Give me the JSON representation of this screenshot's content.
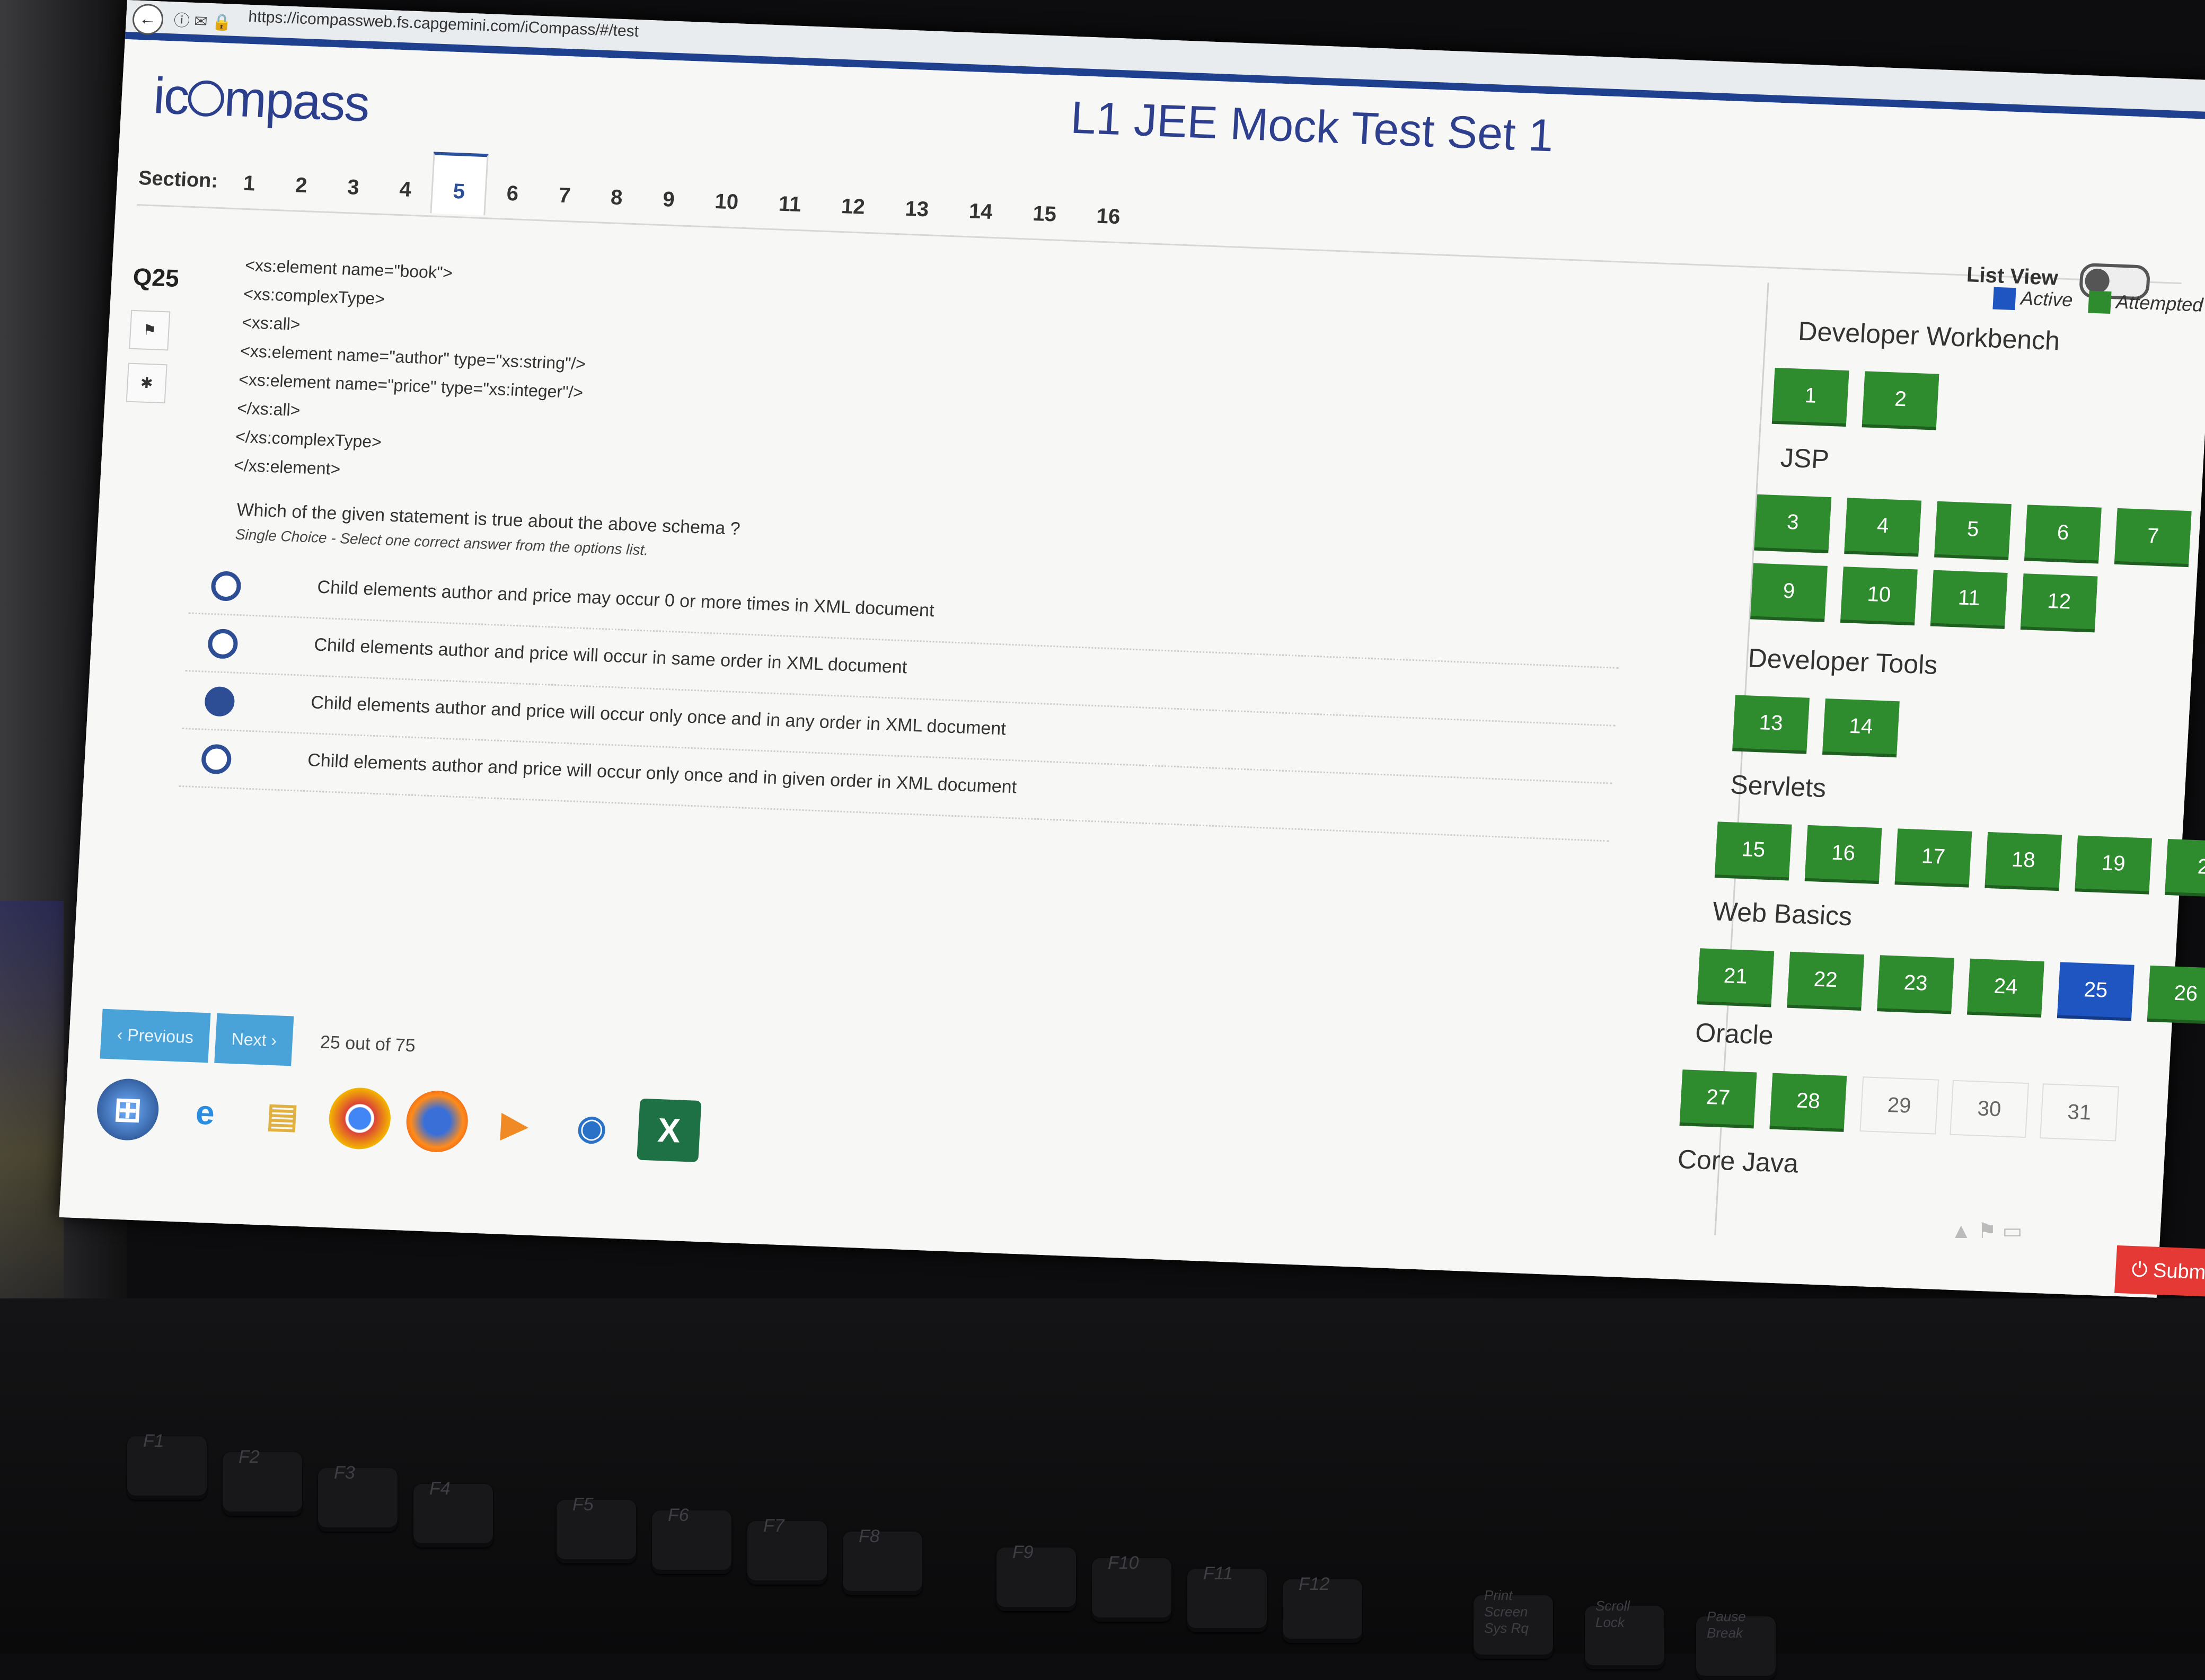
{
  "browser": {
    "url": "https://icompassweb.fs.capgemini.com/iCompass/#/test",
    "back_icon": "arrow-left-icon"
  },
  "app": {
    "logo_text": "icompass",
    "title": "L1 JEE Mock Test Set 1",
    "section_label": "Section:",
    "sections": [
      "1",
      "2",
      "3",
      "4",
      "5",
      "6",
      "7",
      "8",
      "9",
      "10",
      "11",
      "12",
      "13",
      "14",
      "15",
      "16"
    ],
    "active_section": "5",
    "list_view_label": "List View"
  },
  "question": {
    "number": "Q25",
    "code_lines": [
      "<xs:element name=\"book\">",
      "<xs:complexType>",
      "<xs:all>",
      "<xs:element name=\"author\" type=\"xs:string\"/>",
      "<xs:element name=\"price\" type=\"xs:integer\"/>",
      "</xs:all>",
      "</xs:complexType>",
      "</xs:element>"
    ],
    "text": "Which of the given statement is true about the above schema ?",
    "hint": "Single Choice - Select one correct answer from the options list.",
    "options": [
      "Child elements author and price may occur 0 or more times in XML document",
      "Child elements author and price will occur in same order in XML document",
      "Child elements author and price will occur only once and in any order in XML document",
      "Child elements author and price will occur only once and in given order in XML document"
    ],
    "selected_index": 2
  },
  "nav": {
    "previous": "‹ Previous",
    "next": "Next ›",
    "progress": "25 out of 75"
  },
  "legend": {
    "active": "Active",
    "attempted": "Attempted",
    "active_color": "#1f55c0",
    "attempted_color": "#2e8b2e"
  },
  "groups": {
    "developer_workbench": {
      "title": "Developer Workbench",
      "items": [
        "1",
        "2"
      ]
    },
    "jsp": {
      "title": "JSP",
      "row1": [
        "3",
        "4",
        "5",
        "6",
        "7"
      ],
      "row2": [
        "9",
        "10",
        "11",
        "12"
      ]
    },
    "developer_tools": {
      "title": "Developer Tools",
      "items": [
        "13",
        "14"
      ]
    },
    "servlets": {
      "title": "Servlets",
      "items": [
        "15",
        "16",
        "17",
        "18",
        "19",
        "2"
      ]
    },
    "web_basics": {
      "title": "Web Basics",
      "items": [
        "21",
        "22",
        "23",
        "24",
        "25",
        "26"
      ],
      "active": "25"
    },
    "oracle": {
      "title": "Oracle",
      "attempted": [
        "27",
        "28"
      ],
      "unattempted": [
        "29",
        "30",
        "31"
      ]
    },
    "core_java": {
      "title": "Core Java"
    }
  },
  "submit_label": "⏻ Subm",
  "taskbar": [
    "windows-start-icon",
    "internet-explorer-icon",
    "file-explorer-icon",
    "chrome-icon",
    "firefox-icon",
    "media-player-icon",
    "outlook-icon",
    "excel-icon"
  ],
  "keyboard_labels": [
    "F1",
    "F2",
    "F3",
    "F4",
    "F5",
    "F6",
    "F7",
    "F8",
    "F9",
    "F10",
    "F11",
    "F12",
    "Print Screen Sys Rq",
    "Scroll Lock",
    "Pause Break"
  ]
}
